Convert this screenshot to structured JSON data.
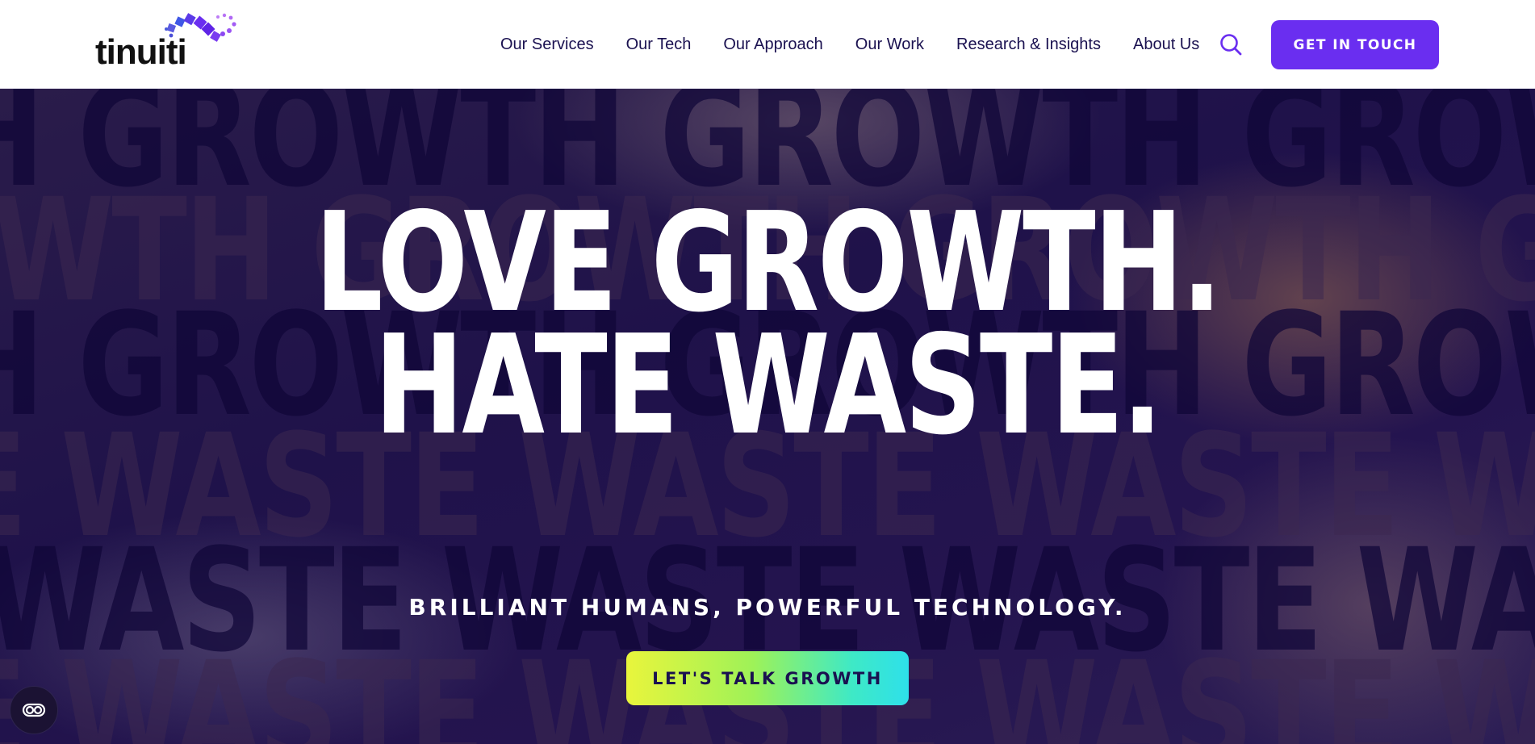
{
  "brand": {
    "logo_text": "tinuiti",
    "accent_color": "#6a2ef0"
  },
  "nav": {
    "items": [
      {
        "label": "Our Services"
      },
      {
        "label": "Our Tech"
      },
      {
        "label": "Our Approach"
      },
      {
        "label": "Our Work"
      },
      {
        "label": "Research & Insights"
      },
      {
        "label": "About Us"
      }
    ],
    "search_icon": "search-icon",
    "cta_label": "GET IN TOUCH"
  },
  "hero": {
    "background_words": [
      "H GROWTH GROWTH GROWTH GROWTH",
      "WTH GROWTH GROWTH GROWTH GROW",
      "H GROWTH GROWTH GROWTH GROWTH",
      "E WASTE WASTE WASTE WASTE WAS",
      "WASTE WASTE WASTE WASTE WASTE",
      "E WASTE WASTE WASTE WASTE WAS"
    ],
    "headline_line1": "LOVE GROWTH.",
    "headline_line2": "HATE WASTE.",
    "subtitle": "BRILLIANT HUMANS, POWERFUL TECHNOLOGY.",
    "cta_label": "LET'S TALK GROWTH"
  },
  "accessibility_widget": {
    "icon": "accessibility-toggle-icon"
  }
}
